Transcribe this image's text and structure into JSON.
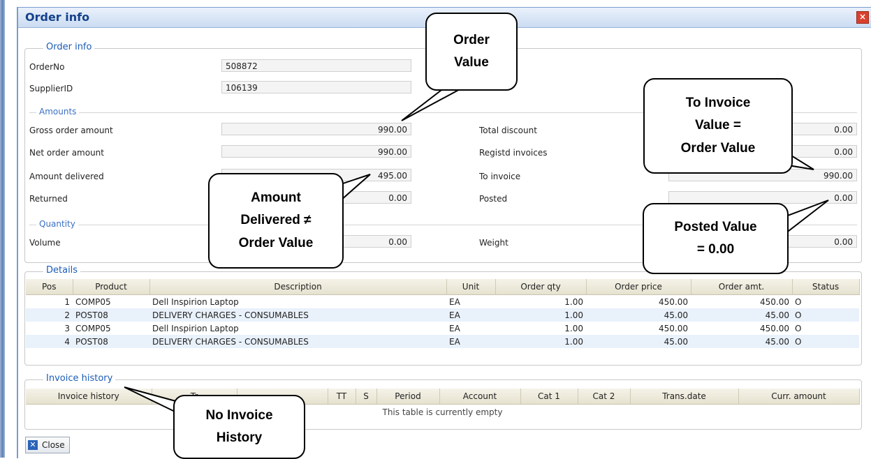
{
  "window": {
    "title": "Order info",
    "close_glyph": "×"
  },
  "order_info": {
    "legend": "Order info",
    "order_no_label": "OrderNo",
    "order_no": "508872",
    "supplier_label": "SupplierID",
    "supplier_id": "106139"
  },
  "amounts": {
    "legend": "Amounts",
    "gross_label": "Gross order amount",
    "gross": "990.00",
    "net_label": "Net order amount",
    "net": "990.00",
    "delivered_label": "Amount delivered",
    "delivered": "495.00",
    "returned_label": "Returned",
    "returned": "0.00",
    "total_discount_label": "Total discount",
    "total_discount": "0.00",
    "registd_label": "Registd invoices",
    "registd": "0.00",
    "to_invoice_label": "To invoice",
    "to_invoice": "990.00",
    "posted_label": "Posted",
    "posted": "0.00"
  },
  "quantity": {
    "legend": "Quantity",
    "volume_label": "Volume",
    "volume": "0.00",
    "weight_label": "Weight",
    "weight": "0.00"
  },
  "details": {
    "legend": "Details",
    "columns": [
      "Pos",
      "Product",
      "Description",
      "Unit",
      "Order qty",
      "Order price",
      "Order amt.",
      "Status"
    ],
    "rows": [
      [
        "1",
        "COMP05",
        "Dell Inspirion Laptop",
        "EA",
        "1.00",
        "450.00",
        "450.00",
        "O"
      ],
      [
        "2",
        "POST08",
        "DELIVERY CHARGES - CONSUMABLES",
        "EA",
        "1.00",
        "45.00",
        "45.00",
        "O"
      ],
      [
        "3",
        "COMP05",
        "Dell Inspirion Laptop",
        "EA",
        "1.00",
        "450.00",
        "450.00",
        "O"
      ],
      [
        "4",
        "POST08",
        "DELIVERY CHARGES - CONSUMABLES",
        "EA",
        "1.00",
        "45.00",
        "45.00",
        "O"
      ]
    ]
  },
  "invoice_history": {
    "legend": "Invoice history",
    "columns": [
      "Invoice history",
      "Tr",
      "",
      "TT",
      "S",
      "Period",
      "Account",
      "Cat 1",
      "Cat 2",
      "Trans.date",
      "Curr. amount"
    ],
    "empty_text": "This table is currently empty"
  },
  "buttons": {
    "close_label": "Close",
    "close_icon": "close-icon"
  },
  "callouts": {
    "order_value": [
      "Order",
      "Value"
    ],
    "to_invoice": [
      "To Invoice",
      "Value =",
      "Order Value"
    ],
    "amount_delivered": [
      "Amount",
      "Delivered ≠",
      "Order Value"
    ],
    "posted": [
      "Posted Value",
      "= 0.00"
    ],
    "no_invoice": [
      "No Invoice",
      "History"
    ]
  }
}
